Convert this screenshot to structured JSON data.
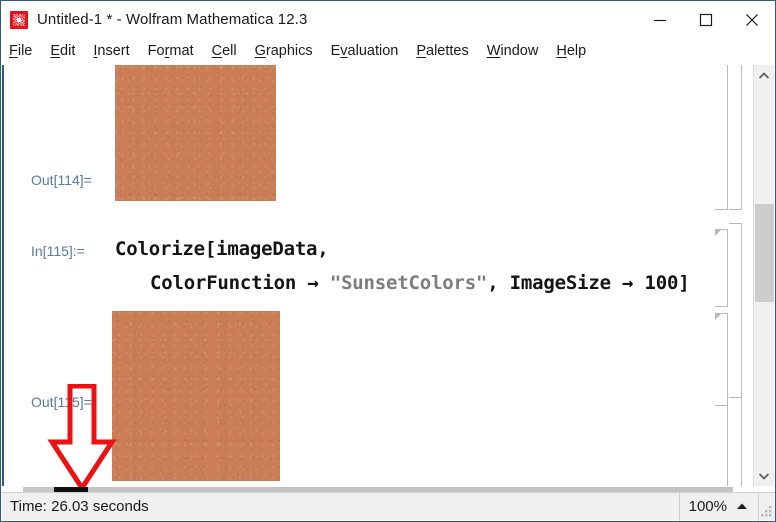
{
  "window": {
    "title": "Untitled-1 * - Wolfram Mathematica 12.3",
    "app_icon": "mathematica-spikey-icon",
    "accent_border": "#2d5d7b",
    "controls": {
      "minimize": "minimize-icon",
      "maximize": "maximize-icon",
      "close": "close-icon"
    }
  },
  "menubar": {
    "items": [
      {
        "label": "File",
        "accel": "F"
      },
      {
        "label": "Edit",
        "accel": "E"
      },
      {
        "label": "Insert",
        "accel": "I"
      },
      {
        "label": "Format",
        "accel": "r"
      },
      {
        "label": "Cell",
        "accel": "C"
      },
      {
        "label": "Graphics",
        "accel": "G"
      },
      {
        "label": "Evaluation",
        "accel": "v"
      },
      {
        "label": "Palettes",
        "accel": "P"
      },
      {
        "label": "Window",
        "accel": "W"
      },
      {
        "label": "Help",
        "accel": "H"
      }
    ]
  },
  "notebook": {
    "cells": [
      {
        "kind": "output",
        "label": "Out[114]=",
        "content": "image-swatch",
        "color": "#cb7e55"
      },
      {
        "kind": "input",
        "label": "In[115]:=",
        "line1": "Colorize[imageData,",
        "line2_a": "ColorFunction → ",
        "line2_str": "\"SunsetColors\"",
        "line2_b": ", ImageSize → 100]"
      },
      {
        "kind": "output",
        "label": "Out[115]=",
        "content": "image-swatch",
        "color": "#cb7e55"
      }
    ]
  },
  "annotation": {
    "shape": "down-arrow",
    "color": "#ee1111"
  },
  "scrollbars": {
    "vertical": {
      "up_arrow": "chevron-up-icon",
      "down_arrow": "chevron-down-icon"
    },
    "horizontal": {}
  },
  "statusbar": {
    "message": "Time: 26.03 seconds",
    "zoom": "100%",
    "zoom_caret": "caret-up-icon",
    "grip": "resize-grip-icon"
  }
}
